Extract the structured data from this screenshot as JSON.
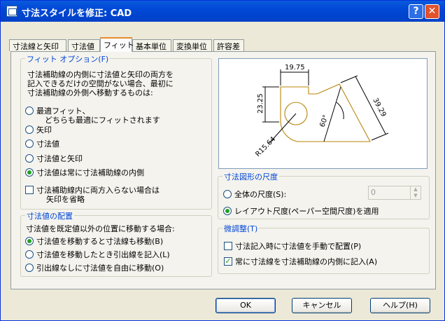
{
  "window": {
    "title": "寸法スタイルを修正: CAD",
    "help_glyph": "?",
    "close_glyph": "✕"
  },
  "tabs": [
    "寸法線と矢印",
    "寸法値",
    "フィット",
    "基本単位",
    "変換単位",
    "許容差"
  ],
  "fit_options": {
    "legend": "フィット オプション(F)",
    "description_lines": [
      "寸法補助線の内側に寸法値と矢印の両方を",
      "記入できるだけの空間がない場合、最初に",
      "寸法補助線の外側へ移動するものは:"
    ],
    "radios": [
      {
        "label": "最適フィット、",
        "sub": "どちらも最適にフィットされます",
        "selected": false
      },
      {
        "label": "矢印",
        "selected": false
      },
      {
        "label": "寸法値",
        "selected": false
      },
      {
        "label": "寸法値と矢印",
        "selected": false
      },
      {
        "label": "寸法値は常に寸法補助線の内側",
        "selected": true
      }
    ],
    "checkbox": {
      "line1": "寸法補助線内に両方入らない場合は",
      "line2": "矢印を省略",
      "checked": false
    }
  },
  "text_placement": {
    "legend": "寸法値の配置",
    "description": "寸法値を既定値以外の位置に移動する場合:",
    "radios": [
      {
        "label": "寸法値を移動すると寸法線も移動(B)",
        "selected": true
      },
      {
        "label": "寸法値を移動したとき引出線を記入(L)",
        "selected": false
      },
      {
        "label": "引出線なしに寸法値を自由に移動(O)",
        "selected": false
      }
    ]
  },
  "preview": {
    "dims": [
      "19.75",
      "23.25",
      "39.29",
      "60°",
      "R15.64"
    ],
    "stroke_color": "#b8860b"
  },
  "scale": {
    "legend": "寸法図形の尺度",
    "radios": [
      {
        "label": "全体の尺度(S):",
        "selected": false
      },
      {
        "label": "レイアウト尺度(ペーパー空間尺度)を適用",
        "selected": true
      }
    ],
    "value": "0"
  },
  "fine_tuning": {
    "legend": "微調整(T)",
    "checks": [
      {
        "label": "寸法記入時に寸法値を手動で配置(P)",
        "checked": false
      },
      {
        "label": "常に寸法線を寸法補助線の内側に記入(A)",
        "checked": true
      }
    ]
  },
  "buttons": {
    "ok": "OK",
    "cancel": "キャンセル",
    "help": "ヘルプ(H)"
  }
}
